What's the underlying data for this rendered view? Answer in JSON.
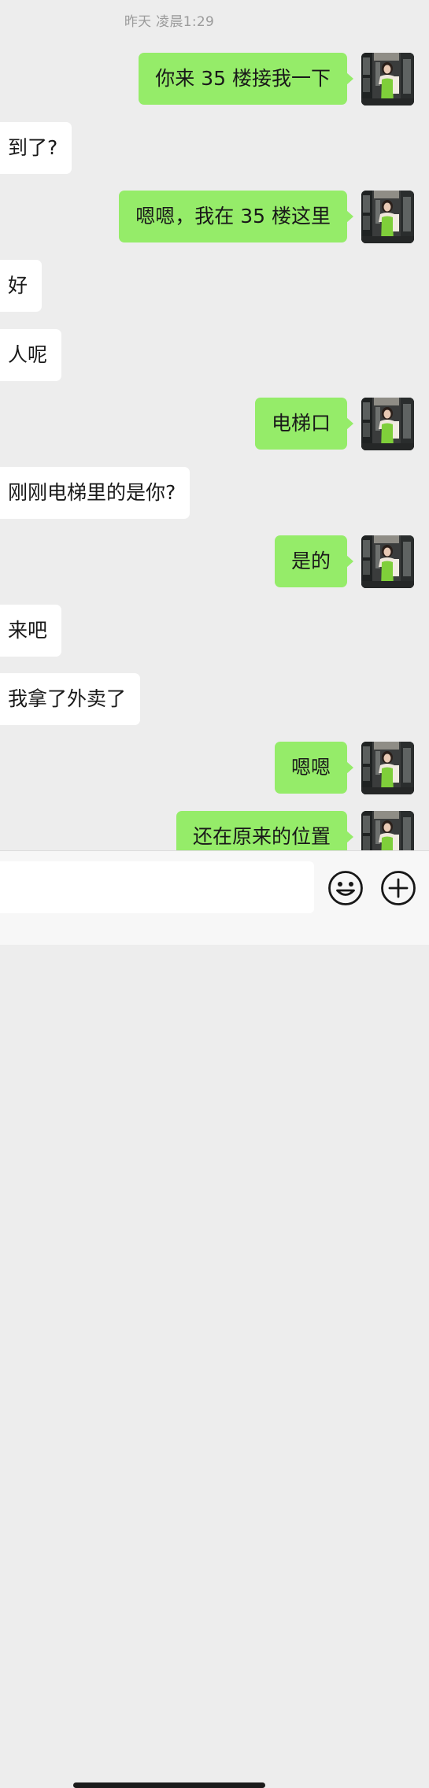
{
  "chat": {
    "timestamp": "昨天 凌晨1:29",
    "messages": [
      {
        "side": "out",
        "text": "你来 35 楼接我一下"
      },
      {
        "side": "in",
        "text": "到了?"
      },
      {
        "side": "out",
        "text": "嗯嗯，我在 35 楼这里"
      },
      {
        "side": "in",
        "text": "好"
      },
      {
        "side": "in",
        "text": "人呢"
      },
      {
        "side": "out",
        "text": "电梯口"
      },
      {
        "side": "in",
        "text": "刚刚电梯里的是你?"
      },
      {
        "side": "out",
        "text": "是的"
      },
      {
        "side": "in",
        "text": "来吧"
      },
      {
        "side": "in",
        "text": "我拿了外卖了"
      },
      {
        "side": "out",
        "text": "嗯嗯"
      },
      {
        "side": "out",
        "text": "还在原来的位置"
      }
    ]
  },
  "input": {
    "value": "",
    "placeholder": ""
  },
  "icons": {
    "emoji": "emoji-icon",
    "add": "plus-circle-icon",
    "avatar": "user-avatar"
  },
  "colors": {
    "background": "#ededed",
    "outgoing_bubble": "#95ec69",
    "incoming_bubble": "#ffffff",
    "timestamp": "#9b9b9b"
  }
}
